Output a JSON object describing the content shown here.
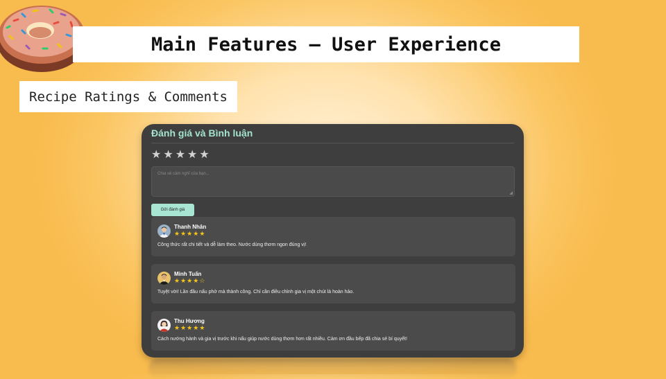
{
  "slide": {
    "title": "Main Features – User Experience",
    "subtitle": "Recipe Ratings & Comments"
  },
  "panel": {
    "title": "Đánh giá và Bình luận",
    "rating_input": {
      "max": 5,
      "selected": 0
    },
    "comment_placeholder": "Chia sẻ cảm nghĩ của bạn...",
    "submit_label": "Gửi đánh giá"
  },
  "reviews": [
    {
      "name": "Thanh Nhân",
      "rating": 5,
      "text": "Công thức rất chi tiết và dễ làm theo. Nước dùng thơm ngon đúng vị!",
      "avatar": "avatar-man-icon"
    },
    {
      "name": "Minh Tuấn",
      "rating": 4,
      "text": "Tuyệt vời! Lần đầu nấu phở mà thành công. Chỉ cần điều chỉnh gia vị một chút là hoàn hảo.",
      "avatar": "avatar-man-icon"
    },
    {
      "name": "Thu Hương",
      "rating": 5,
      "text": "Cách nướng hành và gia vị trước khi nấu giúp nước dùng thơm hơn rất nhiều. Cảm ơn đầu bếp đã chia sẻ bí quyết!",
      "avatar": "avatar-woman-icon"
    }
  ],
  "colors": {
    "accent": "#a8e6d3",
    "star": "#f5c518",
    "panel": "#3e3e3e"
  }
}
